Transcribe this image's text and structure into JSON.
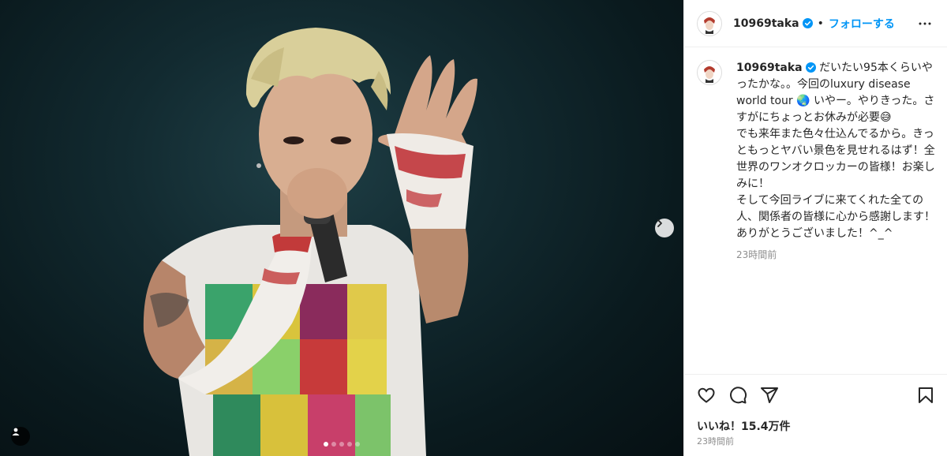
{
  "post": {
    "username": "10969taka",
    "separator": "•",
    "follow_label": "フォローする",
    "caption": "だいたい95本くらいやったかな。。今回のluxury disease world tour 🌏 いやー。やりきった。さすがにちょっとお休みが必要😅\nでも来年また色々仕込んでるから。きっともっとヤバい景色を見せれるはず！全世界のワンオクロッカーの皆様！お楽しみに！\nそして今回ライブに来てくれた全ての人、関係者の皆様に心から感謝します！ありがとうございました！^_^",
    "caption_time": "23時間前",
    "likes": "いいね！15.4万件",
    "post_time": "23時間前"
  },
  "carousel": {
    "total": 5,
    "active_index": 0
  },
  "icons": {
    "verified": "verified-badge-icon",
    "more": "more-options-icon",
    "like": "heart-icon",
    "comment": "comment-icon",
    "share": "share-icon",
    "save": "bookmark-icon",
    "next": "chevron-right-icon",
    "user_tag": "user-tag-icon"
  },
  "colors": {
    "accent": "#0095f6",
    "text": "#262626",
    "muted": "#8e8e8e",
    "media_bg": "#0f2429"
  }
}
